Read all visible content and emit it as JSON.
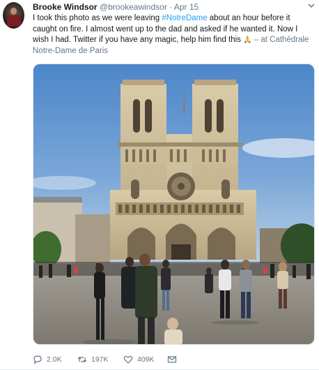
{
  "tweet": {
    "display_name": "Brooke Windsor",
    "handle": "@brookeawindsor",
    "separator": "·",
    "date": "Apr 15",
    "text_part1": "I took this photo as we were leaving ",
    "hashtag": "#NotreDame",
    "text_part2": " about an hour before it caught on fire. I almost went up to the dad and asked if he wanted it. Now I wish I had. Twitter if you have any magic, help him find this ",
    "emoji": "🙏",
    "location_text": " – at Cathédrale Notre-Dame de Paris"
  },
  "actions": {
    "replies": "2.0K",
    "retweets": "197K",
    "likes": "409K"
  },
  "colors": {
    "accent": "#1da1f2",
    "muted": "#657786"
  },
  "icons": {
    "reply": "reply-icon",
    "retweet": "retweet-icon",
    "like": "heart-icon",
    "dm": "envelope-icon",
    "more": "chevron-down-icon"
  }
}
